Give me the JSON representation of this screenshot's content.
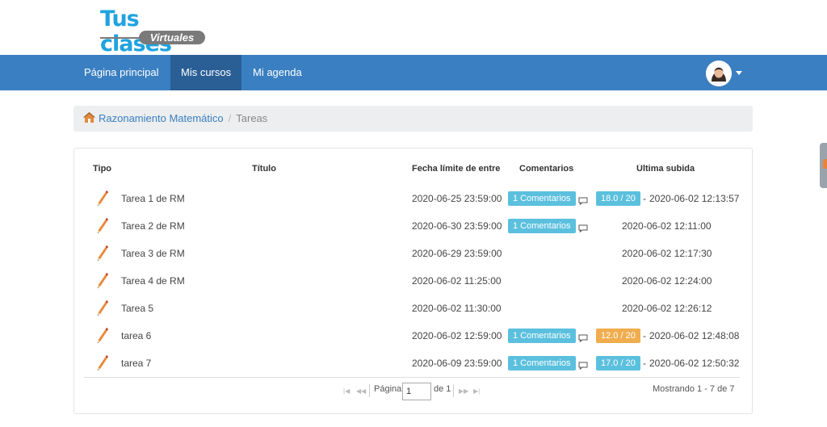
{
  "logo": {
    "line1": "Tus clases",
    "line2": "Virtuales"
  },
  "nav": {
    "items": [
      {
        "label": "Página principal"
      },
      {
        "label": "Mis cursos"
      },
      {
        "label": "Mi agenda"
      }
    ],
    "active": "Mis cursos"
  },
  "breadcrumb": {
    "course": "Razonamiento Matemático",
    "current": "Tareas"
  },
  "table": {
    "headers": {
      "tipo": "Tipo",
      "titulo": "Título",
      "fecha": "Fecha límite de entre",
      "comentarios": "Comentarios",
      "ultima": "Última subida"
    },
    "rows": [
      {
        "title": "Tarea 1 de RM",
        "deadline": "2020-06-25 23:59:00",
        "comments": "1 Comentarios",
        "grade": "18.0 / 20",
        "grade_color": "#5bc0de",
        "last": "2020-06-02 12:13:57"
      },
      {
        "title": "Tarea 2 de RM",
        "deadline": "2020-06-30 23:59:00",
        "comments": "1 Comentarios",
        "grade": "",
        "grade_color": "",
        "last": "2020-06-02 12:11:00"
      },
      {
        "title": "Tarea 3 de RM",
        "deadline": "2020-06-29 23:59:00",
        "comments": "",
        "grade": "",
        "grade_color": "",
        "last": "2020-06-02 12:17:30"
      },
      {
        "title": "Tarea 4 de RM",
        "deadline": "2020-06-02 11:25:00",
        "comments": "",
        "grade": "",
        "grade_color": "",
        "last": "2020-06-02 12:24:00"
      },
      {
        "title": "Tarea 5",
        "deadline": "2020-06-02 11:30:00",
        "comments": "",
        "grade": "",
        "grade_color": "",
        "last": "2020-06-02 12:26:12"
      },
      {
        "title": "tarea 6",
        "deadline": "2020-06-02 12:59:00",
        "comments": "1 Comentarios",
        "grade": "12.0 / 20",
        "grade_color": "#f0ad4e",
        "last": "2020-06-02 12:48:08"
      },
      {
        "title": "tarea 7",
        "deadline": "2020-06-09 23:59:00",
        "comments": "1 Comentarios",
        "grade": "17.0 / 20",
        "grade_color": "#5bc0de",
        "last": "2020-06-02 12:50:32"
      }
    ]
  },
  "pager": {
    "page_label": "Página",
    "page_value": "1",
    "of_label": "de 1",
    "showing": "Mostrando 1 - 7 de 7"
  },
  "icons": {
    "row_type": "pencil-icon",
    "comment": "speech-bubble-icon",
    "home": "home-icon"
  },
  "colors": {
    "navbar": "#3a7fc1",
    "navbar_active": "#2a5f96",
    "info": "#5bc0de",
    "warning": "#f0ad4e",
    "link": "#3a7fc1"
  }
}
